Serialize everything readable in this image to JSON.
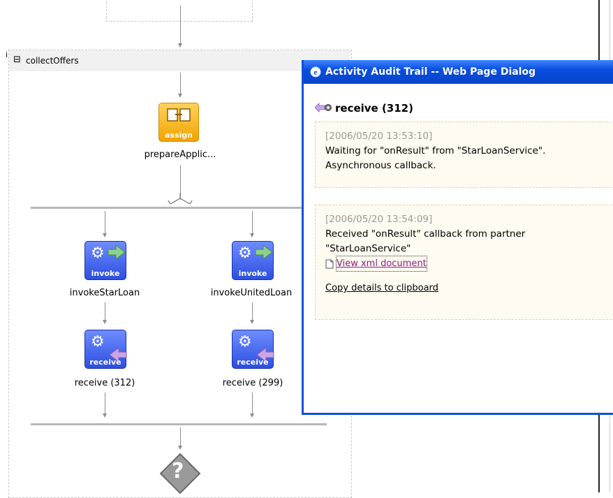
{
  "scope": {
    "name": "collectOffers",
    "collapse_symbol": "⊟",
    "marker": "i"
  },
  "activities": {
    "assign": {
      "icon_word": "assign",
      "label": "prepareApplic..."
    },
    "invoke_star": {
      "icon_word": "invoke",
      "label": "invokeStarLoan"
    },
    "invoke_united": {
      "icon_word": "invoke",
      "label": "invokeUnitedLoan"
    },
    "receive_star": {
      "icon_word": "receive",
      "label": "receive (312)"
    },
    "receive_united": {
      "icon_word": "receive",
      "label": "receive (299)"
    },
    "switch_symbol": "?"
  },
  "dialog": {
    "title": "Activity Audit Trail -- Web Page Dialog",
    "heading": "receive (312)",
    "entries": [
      {
        "timestamp": "[2006/05/20 13:53:10]",
        "line1": "Waiting for \"onResult\" from \"StarLoanService\".",
        "line2": "Asynchronous callback."
      },
      {
        "timestamp": "[2006/05/20 13:54:09]",
        "line1": "Received \"onResult\" callback from partner",
        "line2": "\"StarLoanService\"",
        "link_label": "View xml document",
        "copy_label": "Copy details to clipboard"
      }
    ]
  },
  "colors": {
    "dialog_border": "#0a52d6",
    "assign_icon": "#f2a300",
    "invoke_icon": "#2c4fe0",
    "invoke_arrow": "#8fd08f",
    "receive_arrow": "#c9a7e6",
    "entry_border": "#f0d080",
    "timestamp": "#9a9a9a"
  }
}
